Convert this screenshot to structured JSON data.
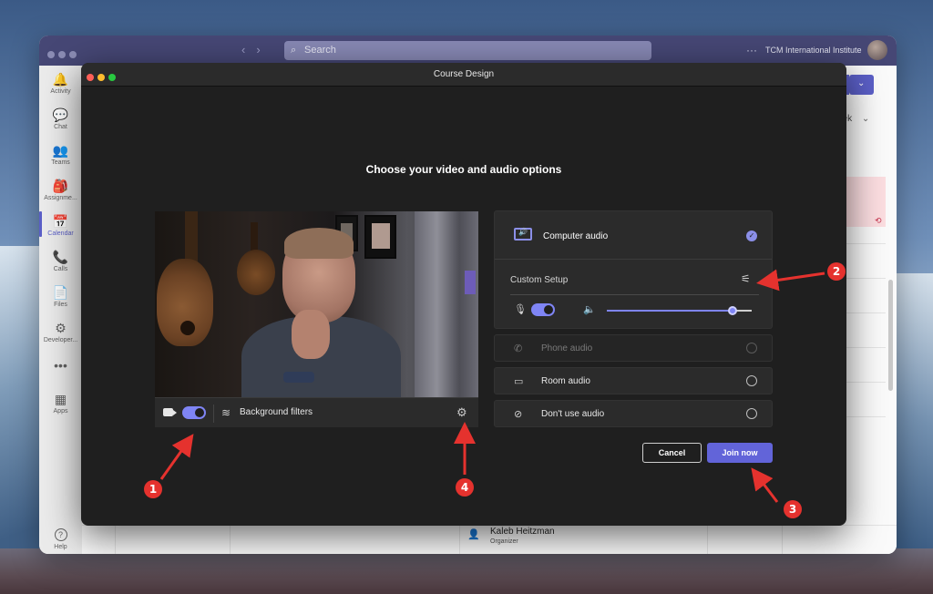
{
  "teams_window": {
    "search_placeholder": "Search",
    "org_name": "TCM International Institute",
    "more": "···",
    "rail": [
      {
        "label": "Activity",
        "icon": "🔔"
      },
      {
        "label": "Chat",
        "icon": "💬"
      },
      {
        "label": "Teams",
        "icon": "👥"
      },
      {
        "label": "Assignme...",
        "icon": "🎒"
      },
      {
        "label": "Calendar",
        "icon": "📅"
      },
      {
        "label": "Calls",
        "icon": "📞"
      },
      {
        "label": "Files",
        "icon": "📄"
      },
      {
        "label": "Developer...",
        "icon": "⚙"
      },
      {
        "label": "",
        "icon": "•••"
      },
      {
        "label": "Apps",
        "icon": "▦"
      },
      {
        "label": "Help",
        "icon": "?"
      }
    ],
    "calendar_view": "eek",
    "organizer_name": "Kaleb Heitzman",
    "organizer_role": "Organizer"
  },
  "dialog": {
    "title": "Course Design",
    "heading": "Choose your video and audio options",
    "background_filters": "Background filters",
    "audio": {
      "computer_audio": "Computer audio",
      "custom_setup": "Custom Setup",
      "phone_audio": "Phone audio",
      "room_audio": "Room audio",
      "dont_use_audio": "Don't use audio",
      "volume": 0.87
    },
    "cancel": "Cancel",
    "join_now": "Join now"
  },
  "annotations": [
    "1",
    "2",
    "3",
    "4"
  ],
  "colors": {
    "accent": "#7f85f5",
    "join": "#6264d9",
    "annotation": "#e5322e",
    "teams_bar": "#464775"
  }
}
